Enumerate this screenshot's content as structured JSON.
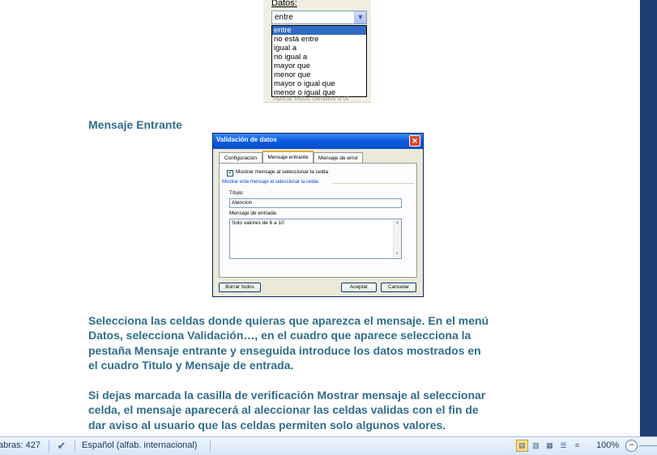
{
  "dropdown_shot": {
    "label": "Datos:",
    "value": "entre",
    "options": [
      "entre",
      "no está entre",
      "igual a",
      "no igual a",
      "mayor que",
      "menor que",
      "mayor o igual que",
      "menor o igual que"
    ],
    "selected_index": 0,
    "fragment": "Aplicar estos cambios a ot"
  },
  "section_heading": "Mensaje Entrante",
  "dialog": {
    "title": "Validación de datos",
    "close": "✕",
    "tabs": [
      {
        "label": "Configuración"
      },
      {
        "label": "Mensaje entrante"
      },
      {
        "label": "Mensaje de error"
      }
    ],
    "active_tab": 1,
    "checkbox_label": "Mostrar mensaje al seleccionar la celda",
    "checkbox_checked": true,
    "group_label": "Mostrar este mensaje al seleccionar la celda:",
    "title_label": "Título:",
    "title_value": "Atencion",
    "message_label": "Mensaje de entrada:",
    "message_value": "Solo valores de 6 a 10",
    "clear_button": "Borrar todos",
    "ok_button": "Aceptar",
    "cancel_button": "Cancelar"
  },
  "paragraph1": [
    "Selecciona las celdas donde quieras que aparezca el mensaje. En el menú",
    "Datos, selecciona Validación…, en el cuadro que aparece selecciona la",
    "pestaña Mensaje entrante y enseguida introduce los datos mostrados en",
    "el cuadro Titulo y Mensaje de entrada."
  ],
  "paragraph2": [
    "Si dejas marcada la casilla de verificación Mostrar mensaje al seleccionar",
    "celda, el mensaje aparecerá al aleccionar las celdas validas con el fin de",
    "dar aviso al usuario que las celdas permiten solo algunos valores."
  ],
  "statusbar": {
    "word_count": "abras: 427",
    "language": "Español (alfab. internacional)",
    "zoom": "100%",
    "zoom_out": "−"
  }
}
